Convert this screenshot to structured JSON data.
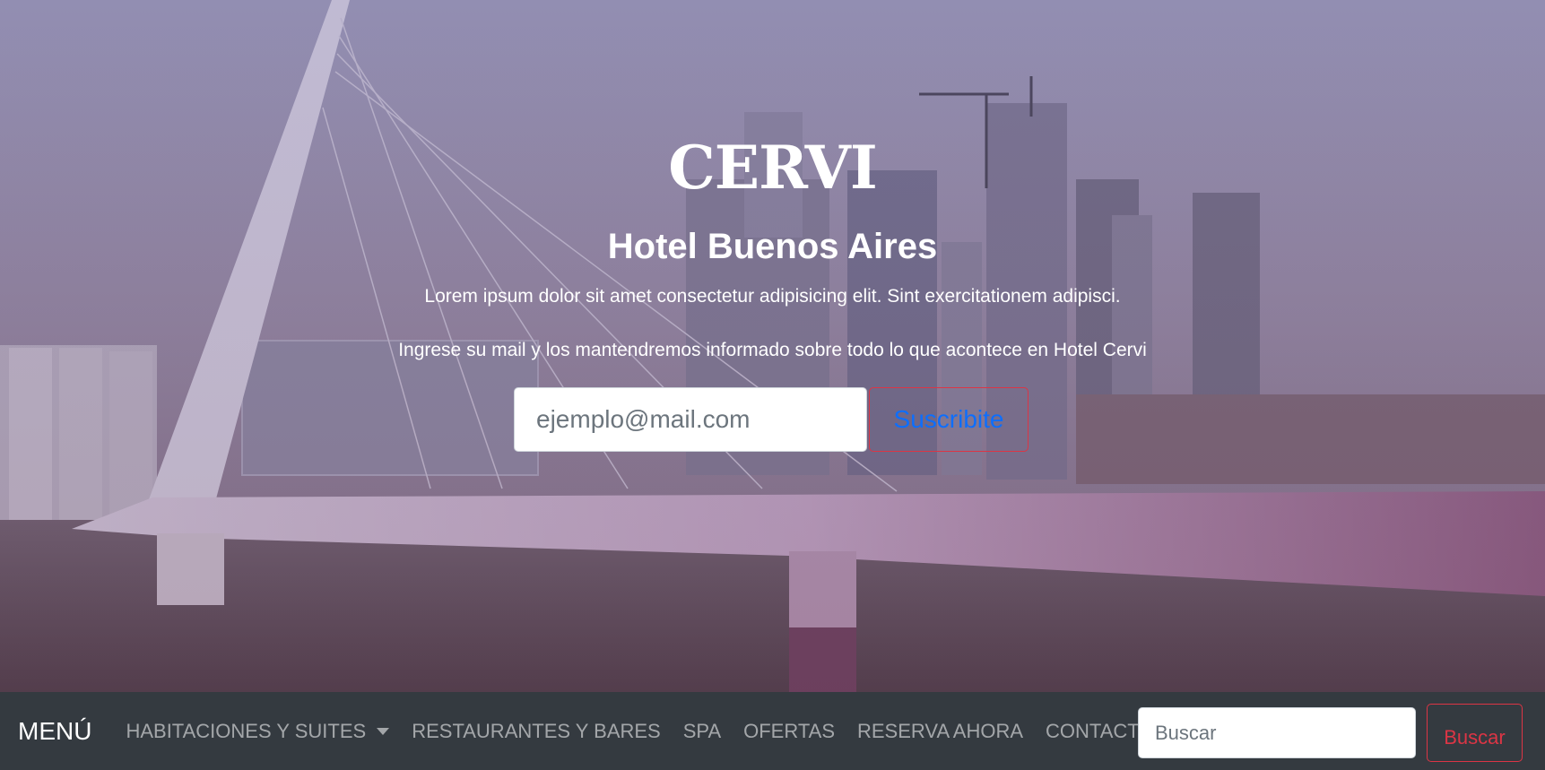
{
  "hero": {
    "logo": "CERVI",
    "title": "Hotel Buenos Aires",
    "subtitle": "Lorem ipsum dolor sit amet consectetur adipisicing elit. Sint exercitationem adipisci.",
    "invite": "Ingrese su mail y los mantendremos informado sobre todo lo que acontece en Hotel Cervi",
    "email_placeholder": "ejemplo@mail.com",
    "subscribe_label": "Suscribite"
  },
  "navbar": {
    "brand": "MENÚ",
    "items": [
      {
        "label": "HABITACIONES Y SUITES",
        "dropdown": true
      },
      {
        "label": "RESTAURANTES Y BARES"
      },
      {
        "label": "SPA"
      },
      {
        "label": "OFERTAS"
      },
      {
        "label": "RESERVA AHORA"
      },
      {
        "label": "CONTACTO"
      }
    ],
    "search_placeholder": "Buscar",
    "search_button": "Buscar"
  },
  "colors": {
    "navbar_bg": "#343a40",
    "danger": "#dc3545",
    "primary": "#0d6efd"
  }
}
